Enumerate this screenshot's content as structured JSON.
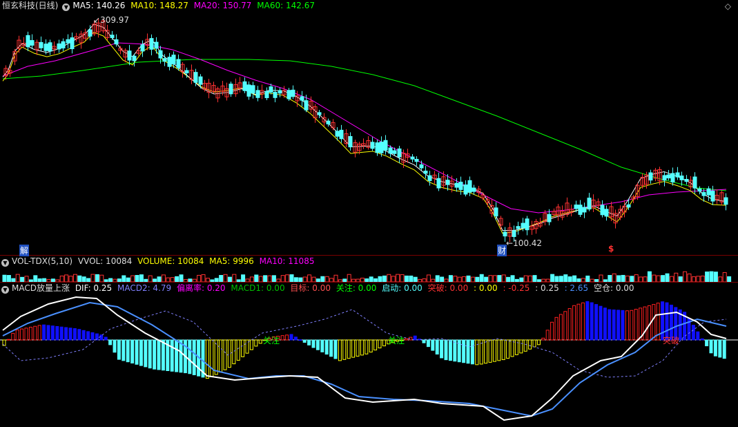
{
  "main_header": {
    "title": "恒玄科技(日线)",
    "ma5": "MA5: 140.26",
    "ma10": "MA10: 148.27",
    "ma20": "MA20: 150.77",
    "ma60": "MA60: 142.67"
  },
  "annotations": {
    "high": "309.97",
    "low": "100.42",
    "jie": "解",
    "cai": "财",
    "dollar": "$"
  },
  "vol_header": {
    "name": "VOL-TDX(5,10)",
    "vvol": "VVOL: 10084",
    "volume": "VOLUME: 10084",
    "ma5": "MA5: 9996",
    "ma10": "MA10: 11085"
  },
  "macd_header": {
    "name": "MACD放量上涨",
    "dif": "DIF: 0.25",
    "macd2": "MACD2: 4.79",
    "pianli": "偏离率: 0.20",
    "macd1": "MACD1: 0.00",
    "mubiao": "目标: 0.00",
    "guanzhu": "关注: 0.00",
    "qidong": "启动: 0.00",
    "tupo": "突破: 0.00",
    "v1": ": 0.00",
    "v2": ": -0.25",
    "v3": ": 0.25",
    "v4": ": 2.65",
    "kongcang": "空仓: 0.00"
  },
  "macd_labels": {
    "guanzhu1": "关注",
    "guanzhu2": "关注",
    "tupo": "突破"
  },
  "colors": {
    "up": "#ff3232",
    "down": "#54ffff",
    "ma5": "#ffffff",
    "ma10": "#ffff00",
    "ma20": "#ff00ff",
    "ma60": "#00ff00",
    "dif": "#ffffff",
    "macd2": "#4a90ff",
    "dea_dash": "#8080ff"
  }
}
